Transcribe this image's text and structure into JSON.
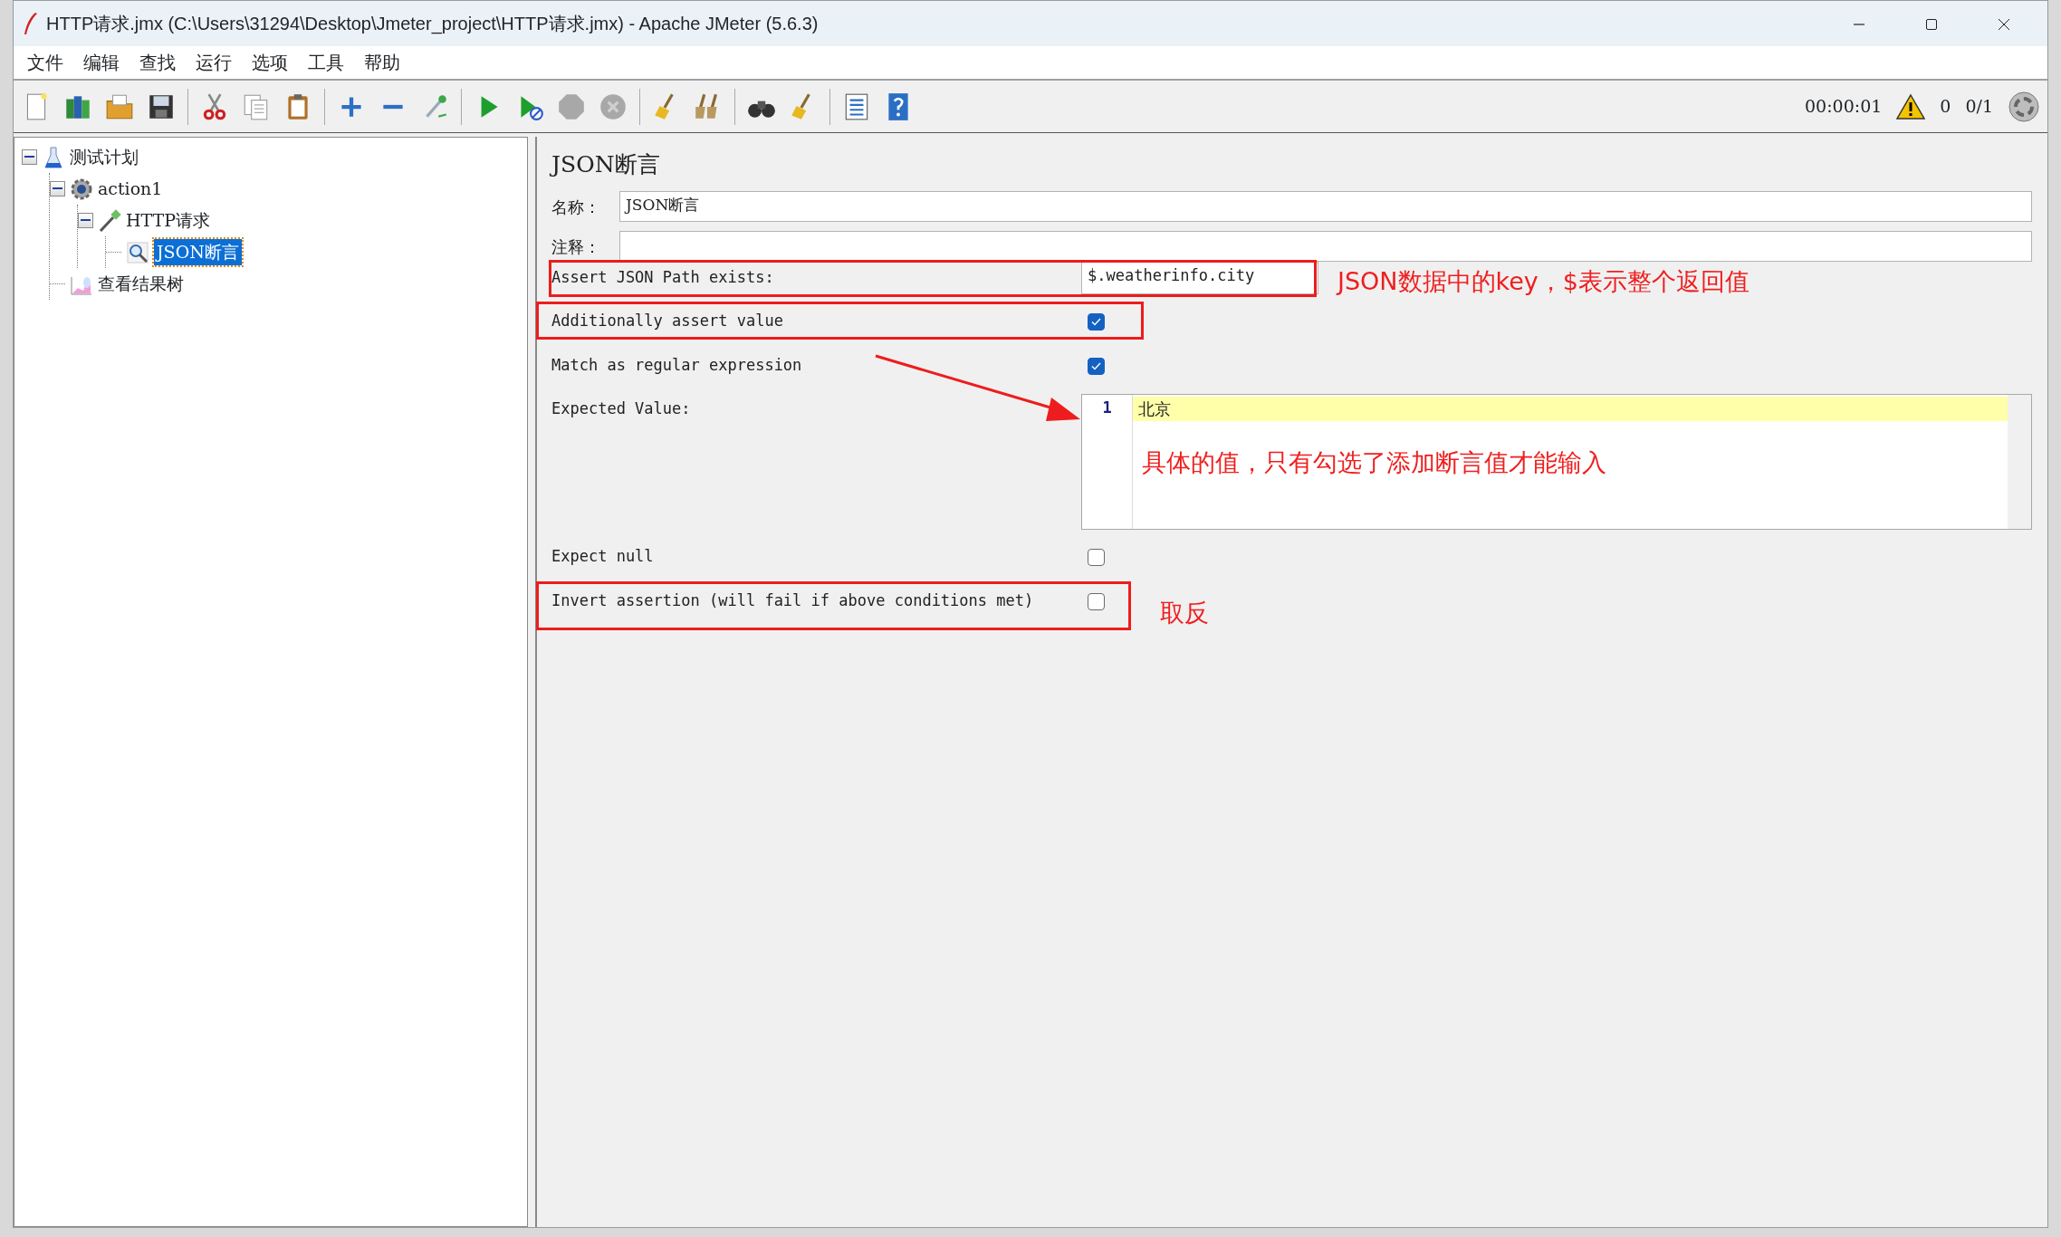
{
  "window": {
    "title": "HTTP请求.jmx (C:\\Users\\31294\\Desktop\\Jmeter_project\\HTTP请求.jmx) - Apache JMeter (5.6.3)"
  },
  "menu": [
    "文件",
    "编辑",
    "查找",
    "运行",
    "选项",
    "工具",
    "帮助"
  ],
  "toolbar": {
    "timer": "00:00:01",
    "error_count": "0",
    "threads": "0/1"
  },
  "tree": [
    {
      "label": "测试计划",
      "kind": "plan",
      "expanded": true,
      "selected": false,
      "children": [
        {
          "label": "action1",
          "kind": "thread-group",
          "expanded": true,
          "selected": false,
          "children": [
            {
              "label": "HTTP请求",
              "kind": "sampler",
              "expanded": true,
              "selected": false,
              "children": [
                {
                  "label": "JSON断言",
                  "kind": "assertion",
                  "selected": true
                }
              ]
            }
          ]
        },
        {
          "label": "查看结果树",
          "kind": "listener",
          "selected": false
        }
      ]
    }
  ],
  "panel": {
    "title": "JSON断言",
    "name": {
      "label": "名称：",
      "value": "JSON断言"
    },
    "comment": {
      "label": "注释："
    },
    "rows": [
      {
        "kind": "path",
        "label": "Assert JSON Path exists:",
        "value": "$.weatherinfo.city",
        "outlined": true
      },
      {
        "kind": "checkbox",
        "label": "Additionally assert value",
        "checked": true,
        "outlined": true
      },
      {
        "kind": "checkbox",
        "label": "Match as regular expression",
        "checked": true,
        "outlined": false
      },
      {
        "kind": "editor",
        "label": "Expected Value:",
        "lines": [
          {
            "number": "1",
            "text": "北京",
            "highlighted": true
          }
        ]
      },
      {
        "kind": "checkbox",
        "label": "Expect null",
        "checked": false,
        "outlined": false
      },
      {
        "kind": "checkbox",
        "label": "Invert assertion (will fail if above conditions met)",
        "checked": false,
        "outlined": true
      }
    ]
  },
  "annotations": [
    {
      "text": "JSON数据中的key，$表示整个返回值"
    },
    {
      "text": "具体的值，只有勾选了添加断言值才能输入"
    },
    {
      "text": "取反"
    }
  ]
}
